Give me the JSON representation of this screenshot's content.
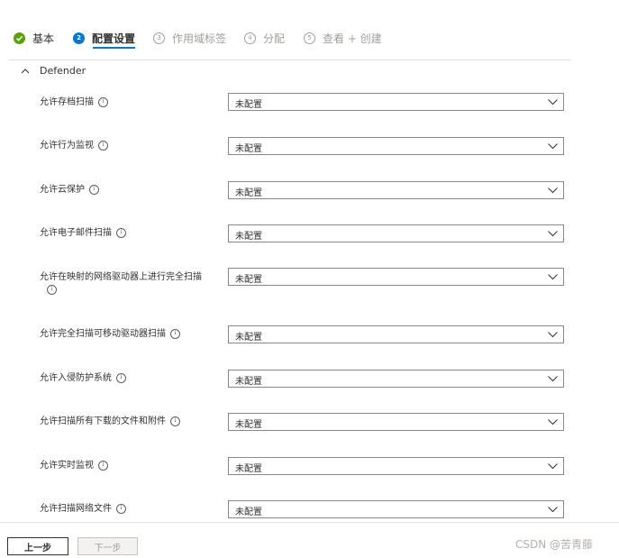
{
  "wizard": {
    "steps": [
      {
        "number": "",
        "label": "基本",
        "state": "done",
        "icon": "check-icon"
      },
      {
        "number": "2",
        "label": "配置设置",
        "state": "current"
      },
      {
        "number": "3",
        "label": "作用域标签",
        "state": "todo"
      },
      {
        "number": "4",
        "label": "分配",
        "state": "todo"
      },
      {
        "number": "5",
        "label": "查看 + 创建",
        "state": "todo"
      }
    ]
  },
  "section": {
    "title": "Defender",
    "expanded": true,
    "icon": "chevron-up-icon"
  },
  "settings": [
    {
      "line1": "允许存档扫描",
      "line2": "",
      "value": "未配置"
    },
    {
      "line1": "允许行为监视",
      "line2": "",
      "value": "未配置"
    },
    {
      "line1": "允许云保护",
      "line2": "",
      "value": "未配置"
    },
    {
      "line1": "允许电子邮件扫描",
      "line2": "",
      "value": "未配置"
    },
    {
      "line1": "允许在映射的网络驱动器上进行完全扫描",
      "line2": "",
      "value": "未配置"
    },
    {
      "line1": "允许完全扫描可移动驱动器扫描",
      "line2": "",
      "value": "未配置"
    },
    {
      "line1": "允许入侵防护系统",
      "line2": "",
      "value": "未配置"
    },
    {
      "line1": "允许扫描所有下载的文件和附件",
      "line2": "",
      "value": "未配置"
    },
    {
      "line1": "允许实时监视",
      "line2": "",
      "value": "未配置"
    },
    {
      "line1": "允许扫描网络文件",
      "line2": "",
      "value": "未配置"
    }
  ],
  "info_glyph": "i",
  "footer": {
    "prev_label": "上一步",
    "next_label": "下一步"
  },
  "watermark": "CSDN @苦青藤",
  "colors": {
    "accent": "#0078d4",
    "done": "#57a300",
    "disabled_text": "#a19f9d",
    "border": "#8a8886"
  }
}
